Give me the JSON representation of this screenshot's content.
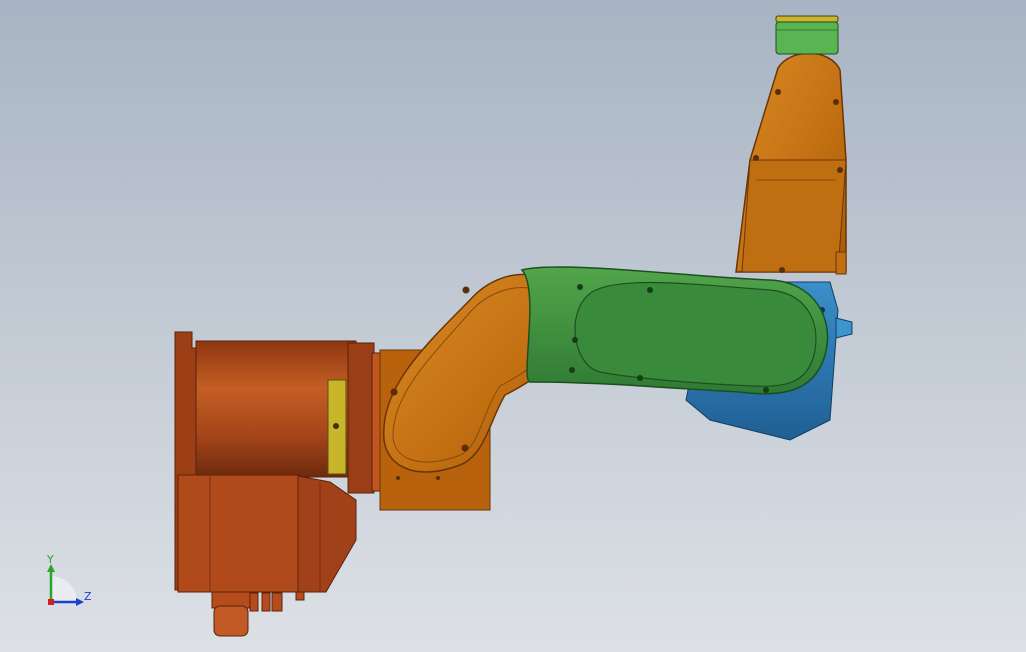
{
  "viewport": {
    "background_top": "#a8b4c3",
    "background_bottom": "#dde1e6"
  },
  "model": {
    "parts": [
      {
        "name": "base",
        "color": "#b4501c"
      },
      {
        "name": "link-1",
        "color": "#c5740f"
      },
      {
        "name": "link-2",
        "color": "#3a8a3c"
      },
      {
        "name": "elbow-motor",
        "color": "#2c7bb4"
      },
      {
        "name": "forearm",
        "color": "#c5740f"
      },
      {
        "name": "flange",
        "color": "#59b451"
      }
    ]
  },
  "triad": {
    "y_label": "Y",
    "z_label": "Z",
    "y_color": "#2aa52a",
    "z_color": "#1a3fd1",
    "x_color": "#d21f1f"
  }
}
